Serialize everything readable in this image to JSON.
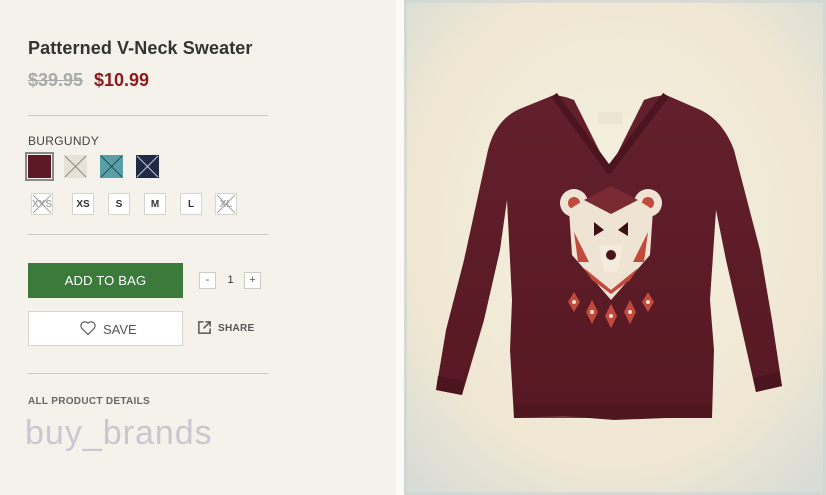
{
  "product": {
    "title": "Patterned V-Neck Sweater",
    "price_original": "$39.95",
    "price_sale": "$10.99"
  },
  "color": {
    "selected_label": "BURGUNDY",
    "swatches": [
      {
        "name": "burgundy",
        "color": "#5c1a26",
        "available": true,
        "selected": true
      },
      {
        "name": "cream",
        "color": "#e8e2d6",
        "available": false
      },
      {
        "name": "teal",
        "color": "#5a9ea8",
        "available": false
      },
      {
        "name": "navy",
        "color": "#1f2a44",
        "available": false
      }
    ]
  },
  "sizes": [
    {
      "label": "XXS",
      "available": false
    },
    {
      "label": "XS",
      "available": true
    },
    {
      "label": "S",
      "available": true
    },
    {
      "label": "M",
      "available": true
    },
    {
      "label": "L",
      "available": true
    },
    {
      "label": "XL",
      "available": false
    }
  ],
  "actions": {
    "add_to_bag": "ADD TO BAG",
    "qty_minus": "-",
    "qty_value": "1",
    "qty_plus": "+",
    "save": "SAVE",
    "share": "SHARE"
  },
  "details_link": "ALL PRODUCT DETAILS",
  "watermark": "buy_brands",
  "colors": {
    "accent_green": "#3b7a3b",
    "sale_red": "#8b1a1a",
    "sweater": "#5e1c28"
  }
}
